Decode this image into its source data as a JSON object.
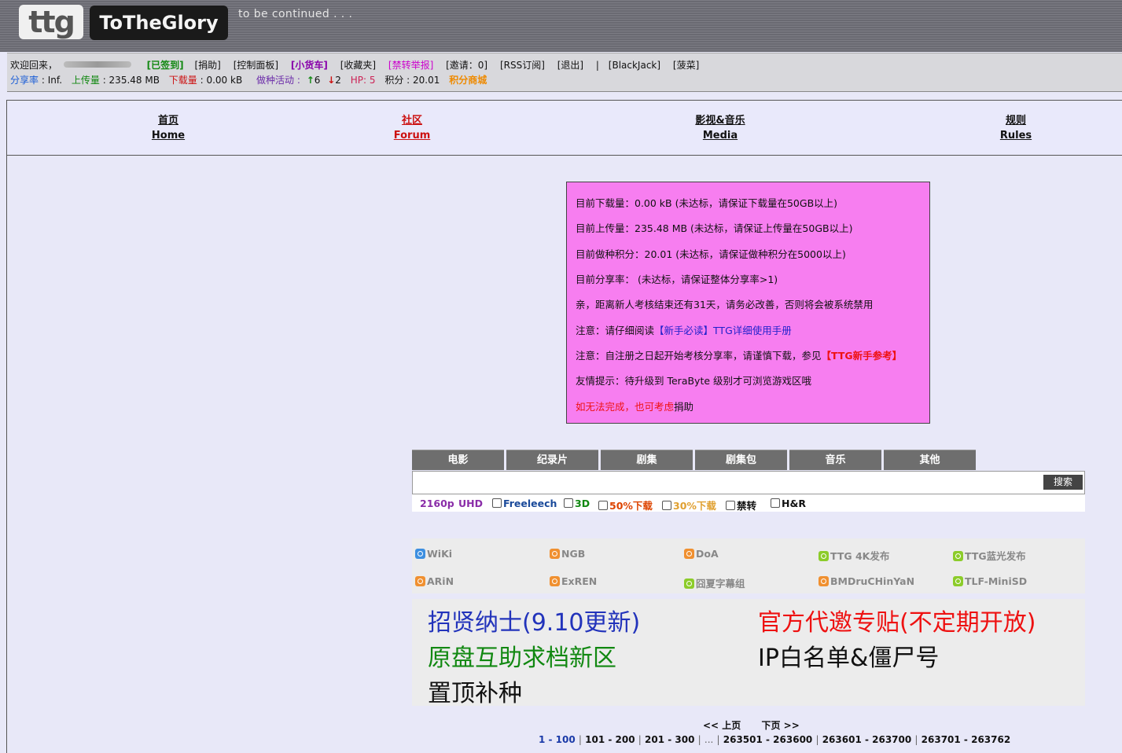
{
  "header": {
    "logo_text": "ttg",
    "brand": "ToTheGlory",
    "tagline": "to be continued . . ."
  },
  "userbar": {
    "welcome": "欢迎回来，",
    "signed": "[已签到]",
    "donate": "[捐助]",
    "control_panel": "[控制面板]",
    "cart": "[小货车]",
    "favorites": "[收藏夹]",
    "report": "[禁转举报]",
    "invite": "[邀请：0]",
    "rss": "[RSS订阅]",
    "logout": "[退出]",
    "sep": "|",
    "blackjack": "[BlackJack]",
    "bocai": "[菠菜]",
    "ratio_label": "分享率",
    "ratio_value": ": Inf.",
    "upload_label": "上传量",
    "upload_value": ": 235.48 MB",
    "download_label": "下载量",
    "download_value": ": 0.00 kB",
    "seeding_label": "做种活动 :",
    "seeding_up": "6",
    "seeding_down": "2",
    "hp": "HP: 5",
    "points": "积分 : 20.01",
    "shop": "积分商城"
  },
  "nav": [
    {
      "cn": "首页",
      "en": "Home",
      "color": "#111111"
    },
    {
      "cn": "社区",
      "en": "Forum",
      "color": "#cc1111"
    },
    {
      "cn": "影视&音乐",
      "en": "Media",
      "color": "#111111"
    },
    {
      "cn": "规则",
      "en": "Rules",
      "color": "#111111"
    }
  ],
  "notice": {
    "bg": "#f77ef0",
    "l1": "目前下载量：0.00 kB (未达标，请保证下载量在50GB以上)",
    "l2": "目前上传量：235.48 MB (未达标，请保证上传量在50GB以上)",
    "l3": "目前做种积分：20.01 (未达标，请保证做种积分在5000以上)",
    "l4": "目前分享率： (未达标，请保证整体分享率>1)",
    "l5": "亲，距离新人考核结束还有31天，请务必改善，否则将会被系统禁用",
    "l6_prefix": "注意：请仔细阅读",
    "l6_link": "【新手必读】TTG详细使用手册",
    "l7_prefix": "注意：自注册之日起开始考核分享率，请谨慎下载，参见",
    "l7_link": "【TTG新手参考】",
    "l8": "友情提示：待升级到 TeraByte 级别才可浏览游戏区哦",
    "l9_red": "如无法完成，也可考虑",
    "l9_link": "捐助"
  },
  "tabs": [
    "电影",
    "纪录片",
    "剧集",
    "剧集包",
    "音乐",
    "其他"
  ],
  "search": {
    "button": "搜索",
    "value": ""
  },
  "filters": {
    "f2160": "2160p",
    "uhd": "UHD",
    "freeleech": "Freeleech",
    "d3": "3D",
    "half": "50%下载",
    "thirty": "30%下载",
    "jinzhuan": "禁转",
    "hr": "H&R"
  },
  "links": [
    {
      "label": "WiKi",
      "icon": "blue-circle-icon",
      "color": "#3d8fe0"
    },
    {
      "label": "NGB",
      "icon": "orange-circle-icon",
      "color": "#f09030"
    },
    {
      "label": "DoA",
      "icon": "orange-circle-icon",
      "color": "#f09030"
    },
    {
      "label": "TTG 4K发布",
      "icon": "green-circle-icon",
      "color": "#8ccc2a"
    },
    {
      "label": "TTG蓝光发布",
      "icon": "green-circle-icon",
      "color": "#8ccc2a"
    },
    {
      "label": "ARiN",
      "icon": "orange-circle-icon",
      "color": "#f09030"
    },
    {
      "label": "ExREN",
      "icon": "orange-circle-icon",
      "color": "#f09030"
    },
    {
      "label": "囧夏字幕组",
      "icon": "green-circle-icon",
      "color": "#8ccc2a"
    },
    {
      "label": "BMDruCHinYaN",
      "icon": "orange-circle-icon",
      "color": "#f09030"
    },
    {
      "label": "TLF-MiniSD",
      "icon": "green-circle-icon",
      "color": "#8ccc2a"
    }
  ],
  "big_links": {
    "recruit": "招贤纳士(9.10更新)",
    "invite": "官方代邀专贴(不定期开放)",
    "original": "原盘互助求档新区",
    "ip": "IP白名单&僵尸号",
    "pin": "置顶补种"
  },
  "pager": {
    "prev": "<< 上页",
    "next": "下页 >>",
    "p1": "1 - 100",
    "p2": "101 - 200",
    "p3": "201 - 300",
    "ellipsis": "...",
    "p4": "263501 - 263600",
    "p5": "263601 - 263700",
    "p6": "263701 - 263762",
    "sep": "|"
  }
}
